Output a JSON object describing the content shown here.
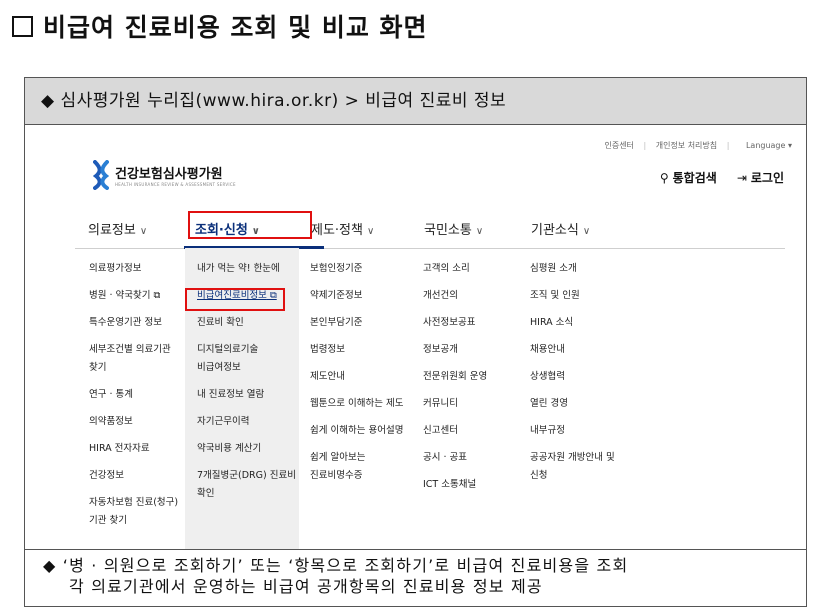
{
  "document": {
    "title": "비급여 진료비용 조회 및 비교 화면",
    "caption": "◆ 심사평가원 누리집(www.hira.or.kr) > 비급여 진료비 정보",
    "footer_line1": "◆ ‘병 · 의원으로 조회하기’ 또는 ‘항목으로 조회하기’로 비급여 진료비용을 조회",
    "footer_line2": "각 의료기관에서 운영하는 비급여 공개항목의 진료비용 정보 제공"
  },
  "site": {
    "util_links": [
      "인증센터",
      "개인정보 처리방침",
      "Language"
    ],
    "logo_name": "건강보험심사평가원",
    "logo_sub": "HEALTH INSURANCE REVIEW & ASSESSMENT SERVICE",
    "search_label": "통합검색",
    "login_label": "로그인",
    "nav": [
      "의료정보",
      "조회·신청",
      "제도·정책",
      "국민소통",
      "기관소식"
    ],
    "menu_cols": [
      [
        "의료평가정보",
        "병원 · 약국찾기",
        "특수운영기관 정보",
        "세부조건별 의료기관",
        "찾기",
        "연구 · 통계",
        "의약품정보",
        "HIRA 전자자료",
        "건강정보",
        "자동차보험 진료(청구)",
        "기관 찾기"
      ],
      [
        "내가 먹는 약! 한눈에",
        "비급여진료비정보",
        "진료비 확인",
        "디지털의료기술",
        "비급여정보",
        "내 진료정보 열람",
        "자기근무이력",
        "약국비용 계산기",
        "7개질병군(DRG) 진료비",
        "확인"
      ],
      [
        "보험인정기준",
        "약제기준정보",
        "본인부담기준",
        "법령정보",
        "제도안내",
        "웹툰으로 이해하는 제도",
        "쉽게 이해하는 용어설명",
        "쉽게 알아보는",
        "진료비명수증"
      ],
      [
        "고객의 소리",
        "개선건의",
        "사전정보공표",
        "정보공개",
        "전문위원회 운영",
        "커뮤니티",
        "신고센터",
        "공시 · 공표",
        "ICT 소통채널"
      ],
      [
        "심평원 소개",
        "조직 및 인원",
        "HIRA 소식",
        "채용안내",
        "상생협력",
        "열린 경영",
        "내부규정",
        "공공자원 개방안내 및",
        "신청"
      ]
    ]
  }
}
